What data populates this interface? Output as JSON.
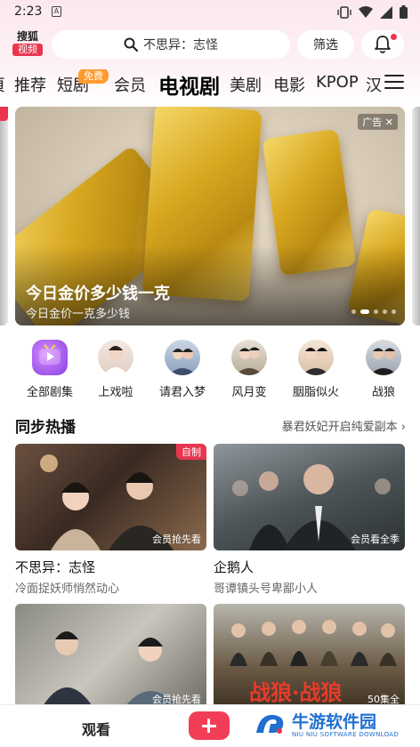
{
  "status": {
    "time": "2:23",
    "sim_glyph": "A"
  },
  "header": {
    "logo_line1": "搜狐",
    "logo_line2": "视频",
    "search_text": "不思异：志怪",
    "filter_label": "筛选"
  },
  "tabs": [
    {
      "label": "推荐"
    },
    {
      "label": "短剧"
    },
    {
      "label": "会员"
    },
    {
      "label": "电视剧",
      "active": true
    },
    {
      "label": "美剧"
    },
    {
      "label": "电影"
    },
    {
      "label": "KPOP"
    },
    {
      "label": "汉"
    }
  ],
  "tab_badge": "免费",
  "banner": {
    "title": "今日金价多少钱一克",
    "subtitle": "今日金价一克多少钱",
    "ad_label": "广告 ✕"
  },
  "categories": [
    {
      "label": "全部剧集"
    },
    {
      "label": "上戏啦"
    },
    {
      "label": "请君入梦"
    },
    {
      "label": "风月变"
    },
    {
      "label": "胭脂似火"
    },
    {
      "label": "战狼"
    }
  ],
  "section": {
    "title": "同步热播",
    "more": "暴君妖妃开启纯爱副本 ›"
  },
  "cards": [
    {
      "name": "不思异：志怪",
      "desc": "冷面捉妖师悄然动心",
      "tag": "自制",
      "overlay": "会员抢先看"
    },
    {
      "name": "企鹅人",
      "desc": "哥谭镇头号卑鄙小人",
      "tag": "",
      "overlay": "会员看全季"
    },
    {
      "name": "",
      "desc": "",
      "tag": "",
      "overlay": "会员抢先看"
    },
    {
      "name": "",
      "desc": "",
      "tag": "",
      "overlay": "50集全"
    }
  ],
  "bottom": {
    "watch_label": "观看"
  },
  "watermark": {
    "name": "牛游软件园",
    "sub": "NIU NIU SOFTWARE DOWNLOAD"
  },
  "colors": {
    "accent": "#e8364f",
    "badge": "#ff9a2e",
    "watermark": "#1f6fd1"
  }
}
